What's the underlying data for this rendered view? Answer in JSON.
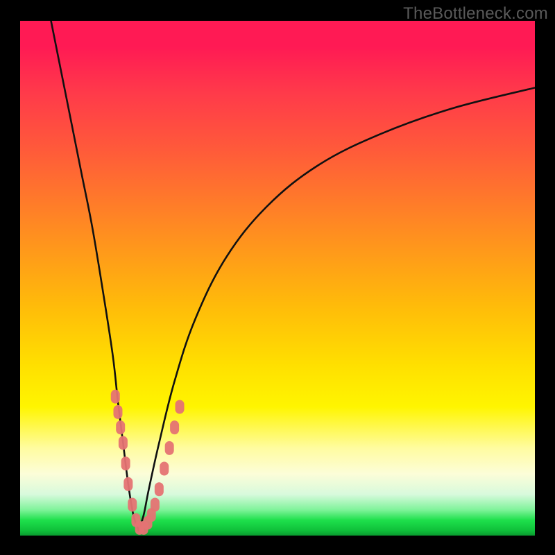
{
  "watermark": "TheBottleneck.com",
  "colors": {
    "background_border": "#000000",
    "curve_stroke": "#111111",
    "marker_fill": "#e57373",
    "gradient_top": "#ff1a54",
    "gradient_mid": "#ffe000",
    "gradient_bottom": "#0a9c30"
  },
  "chart_data": {
    "type": "line",
    "title": "",
    "xlabel": "",
    "ylabel": "",
    "xlim": [
      0,
      100
    ],
    "ylim": [
      0,
      100
    ],
    "note": "V-shaped bottleneck curve; minimum near x≈23. Values estimated from pixel positions (no numeric axes shown).",
    "series": [
      {
        "name": "left-branch",
        "x": [
          6,
          8,
          10,
          12,
          14,
          16,
          18,
          19,
          20,
          21,
          22,
          23
        ],
        "y": [
          100,
          90,
          80,
          70,
          60,
          48,
          35,
          26,
          18,
          10,
          4,
          1
        ]
      },
      {
        "name": "right-branch",
        "x": [
          23,
          24,
          25,
          27,
          30,
          34,
          40,
          48,
          58,
          70,
          84,
          100
        ],
        "y": [
          1,
          4,
          9,
          18,
          30,
          42,
          54,
          64,
          72,
          78,
          83,
          87
        ]
      }
    ],
    "markers": {
      "name": "highlighted-points",
      "x": [
        18.5,
        19.0,
        19.5,
        20.0,
        20.5,
        21.0,
        21.8,
        22.5,
        23.2,
        24.0,
        24.8,
        25.5,
        26.2,
        27.0,
        28.0,
        29.0,
        30.0,
        31.0
      ],
      "y": [
        27,
        24,
        21,
        18,
        14,
        10,
        6,
        3,
        1.5,
        1.5,
        2.5,
        4,
        6,
        9,
        13,
        17,
        21,
        25
      ]
    }
  }
}
